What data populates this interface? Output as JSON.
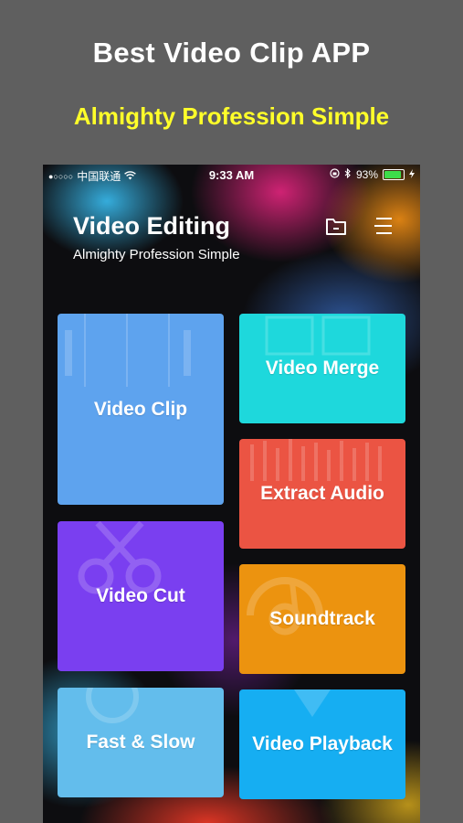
{
  "promo": {
    "title": "Best Video Clip APP",
    "subtitle": "Almighty Profession Simple"
  },
  "status_bar": {
    "carrier": "中国联通",
    "time": "9:33 AM",
    "battery": "93%"
  },
  "header": {
    "title": "Video Editing",
    "subtitle": "Almighty Profession Simple",
    "icons": [
      "folder-icon",
      "menu-icon"
    ]
  },
  "tiles": [
    {
      "label": "Video Clip",
      "color": "#5ea3ee"
    },
    {
      "label": "Video Merge",
      "color": "#1ed8dc"
    },
    {
      "label": "Extract Audio",
      "color": "#eb5443"
    },
    {
      "label": "Video Cut",
      "color": "#7a3ff0"
    },
    {
      "label": "Soundtrack",
      "color": "#ec930f"
    },
    {
      "label": "Fast & Slow",
      "color": "#63bdec"
    },
    {
      "label": "Video Playback",
      "color": "#16aef2"
    }
  ]
}
